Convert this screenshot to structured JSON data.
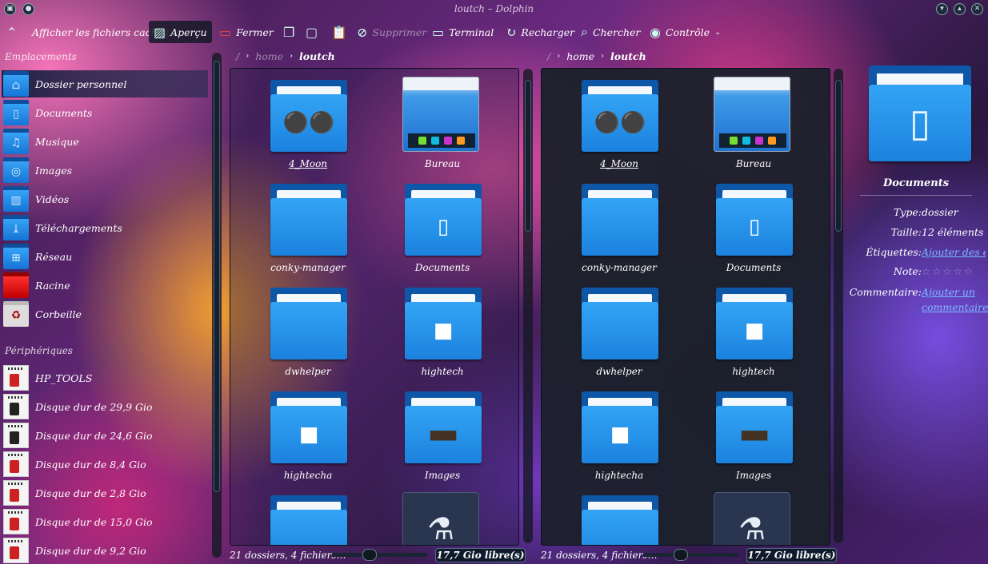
{
  "window": {
    "title": "loutch – Dolphin"
  },
  "toolbar": {
    "hidden_files": "Afficher les fichiers cachés",
    "preview": "Aperçu",
    "close": "Fermer",
    "delete": "Supprimer",
    "terminal": "Terminal",
    "reload": "Recharger",
    "search": "Chercher",
    "control": "Contrôle"
  },
  "sidebar": {
    "places_header": "Emplacements",
    "places": [
      {
        "label": "Dossier personnel",
        "icon": "home-icon",
        "selected": true
      },
      {
        "label": "Documents",
        "icon": "document-icon"
      },
      {
        "label": "Musique",
        "icon": "music-icon"
      },
      {
        "label": "Images",
        "icon": "camera-icon"
      },
      {
        "label": "Vidéos",
        "icon": "video-icon"
      },
      {
        "label": "Téléchargements",
        "icon": "download-icon"
      },
      {
        "label": "Réseau",
        "icon": "network-icon"
      },
      {
        "label": "Racine",
        "icon": "root-folder-icon"
      },
      {
        "label": "Corbeille",
        "icon": "trash-icon"
      }
    ],
    "devices_header": "Périphériques",
    "devices": [
      {
        "label": "HP_TOOLS"
      },
      {
        "label": "Disque dur de 29,9 Gio"
      },
      {
        "label": "Disque dur de 24,6 Gio"
      },
      {
        "label": "Disque dur de 8,4 Gio"
      },
      {
        "label": "Disque dur de 2,8 Gio"
      },
      {
        "label": "Disque dur de 15,0 Gio"
      },
      {
        "label": "Disque dur de 9,2 Gio"
      }
    ]
  },
  "left_pane": {
    "breadcrumb": {
      "root": "/",
      "home": "home",
      "current": "loutch"
    },
    "items": [
      "4_Moon",
      "Bureau",
      "conky-manager",
      "Documents",
      "dwhelper",
      "hightech",
      "hightecha",
      "Images"
    ],
    "status": "21 dossiers, 4 fichiers…",
    "free_space": "17,7 Gio libre(s)"
  },
  "right_pane": {
    "breadcrumb": {
      "root": "/",
      "home": "home",
      "current": "loutch"
    },
    "items": [
      "4_Moon",
      "Bureau",
      "conky-manager",
      "Documents",
      "dwhelper",
      "hightech",
      "hightecha",
      "Images"
    ],
    "status": "21 dossiers, 4 fichiers…",
    "free_space": "17,7 Gio libre(s)"
  },
  "info_panel": {
    "name": "Documents",
    "type_label": "Type:",
    "type_value": "dossier",
    "size_label": "Taille:",
    "size_value": "12 éléments",
    "tags_label": "Étiquettes:",
    "tags_value": "Ajouter des étiquettes",
    "rating_label": "Note:",
    "comment_label": "Commentaire:",
    "comment_value_1": "Ajouter un",
    "comment_value_2": "commentaire…"
  },
  "colors": {
    "accent": "#1b82de",
    "selection": "#141e3c",
    "link": "#7fb8ff"
  }
}
